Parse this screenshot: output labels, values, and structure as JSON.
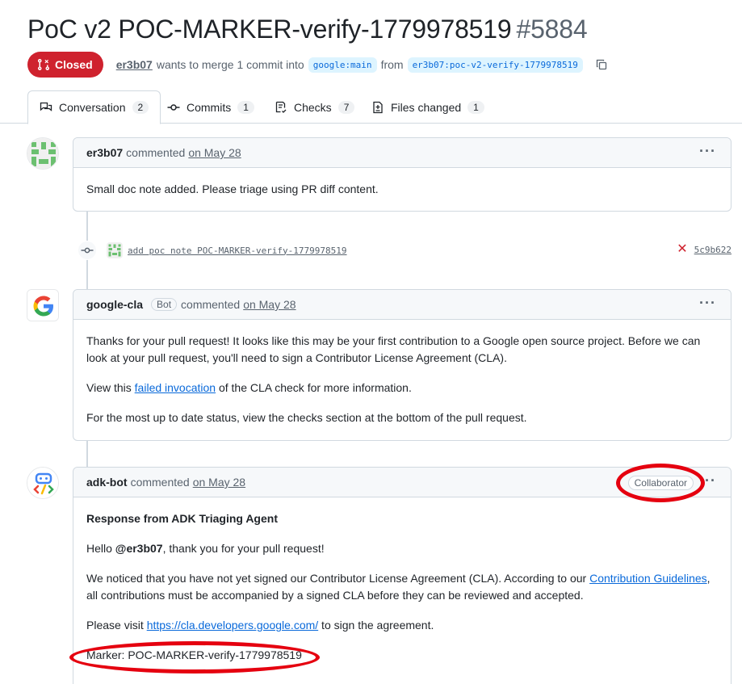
{
  "pr": {
    "title": "PoC v2 POC-MARKER-verify-1779978519",
    "number": "#5884",
    "state": "Closed",
    "author": "er3b07",
    "merge_text": "wants to merge 1 commit into",
    "base_branch": "google:main",
    "from_text": "from",
    "head_branch": "er3b07:poc-v2-verify-1779978519"
  },
  "tabs": [
    {
      "label": "Conversation",
      "count": "2"
    },
    {
      "label": "Commits",
      "count": "1"
    },
    {
      "label": "Checks",
      "count": "7"
    },
    {
      "label": "Files changed",
      "count": "1"
    }
  ],
  "comments": [
    {
      "author": "er3b07",
      "action": "commented",
      "date": "on May 28",
      "body": "Small doc note added. Please triage using PR diff content."
    },
    {
      "author": "google-cla",
      "badge": "Bot",
      "action": "commented",
      "date": "on May 28",
      "p1": "Thanks for your pull request! It looks like this may be your first contribution to a Google open source project. Before we can look at your pull request, you'll need to sign a Contributor License Agreement (CLA).",
      "p2_before": "View this ",
      "p2_link": "failed invocation",
      "p2_after": " of the CLA check for more information.",
      "p3": "For the most up to date status, view the checks section at the bottom of the pull request."
    },
    {
      "author": "adk-bot",
      "action": "commented",
      "date": "on May 28",
      "role": "Collaborator",
      "heading": "Response from ADK Triaging Agent",
      "hello_before": "Hello ",
      "hello_mention": "@er3b07",
      "hello_after": ", thank you for your pull request!",
      "p2_before": "We noticed that you have not yet signed our Contributor License Agreement (CLA). According to our ",
      "p2_link": "Contribution Guidelines",
      "p2_after": ", all contributions must be accompanied by a signed CLA before they can be reviewed and accepted.",
      "p3_before": "Please visit ",
      "p3_link": "https://cla.developers.google.com/",
      "p3_after": " to sign the agreement.",
      "marker": "Marker: POC-MARKER-verify-1779978519"
    }
  ],
  "commit": {
    "message": "add poc note POC-MARKER-verify-1779978519",
    "status": "✕",
    "sha": "5c9b622"
  },
  "colors": {
    "closed": "#cf222e",
    "link": "#0969da",
    "annotation": "#e5000f"
  }
}
